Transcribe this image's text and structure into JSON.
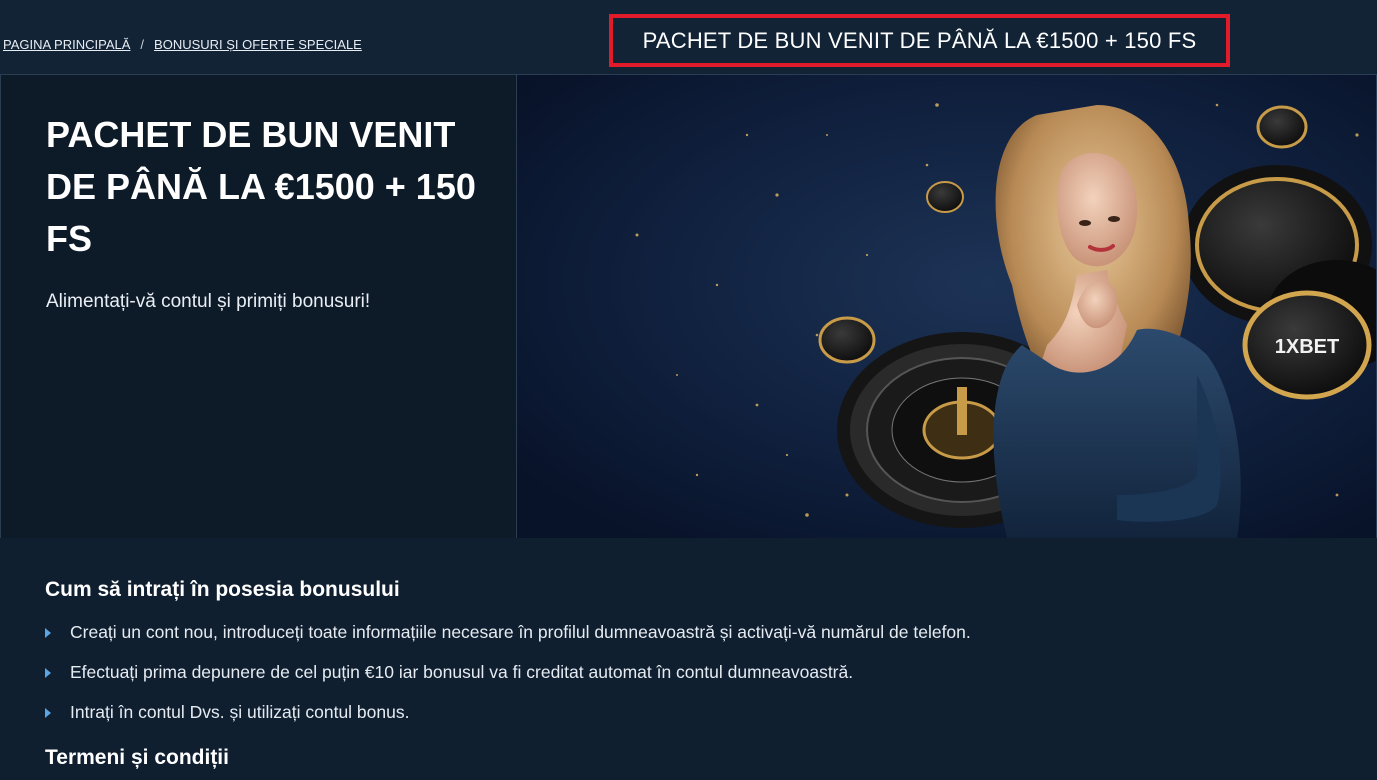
{
  "breadcrumb": {
    "home": "PAGINA PRINCIPALĂ",
    "separator": "/",
    "current": "BONUSURI ȘI OFERTE SPECIALE"
  },
  "page_heading": "PACHET DE BUN VENIT DE PÂNĂ LA €1500 + 150 FS",
  "hero": {
    "title": "PACHET DE BUN VENIT DE PÂNĂ LA €1500 + 150 FS",
    "subtitle": "Alimentați-vă contul și primiți bonusuri!",
    "chip_logo": "1XBET"
  },
  "how_to": {
    "heading": "Cum să intrați în posesia bonusului",
    "steps": [
      "Creați un cont nou, introduceți toate informațiile necesare în profilul dumneavoastră și activați-vă numărul de telefon.",
      "Efectuați prima depunere de cel puțin €10 iar bonusul va fi creditat automat în contul dumneavoastră.",
      "Intrați în contul Dvs. și utilizați contul bonus."
    ]
  },
  "terms": {
    "heading": "Termeni și condiții"
  },
  "colors": {
    "highlight_border": "#e21b2a",
    "bullet": "#5aa5e6",
    "background": "#0f2032"
  }
}
